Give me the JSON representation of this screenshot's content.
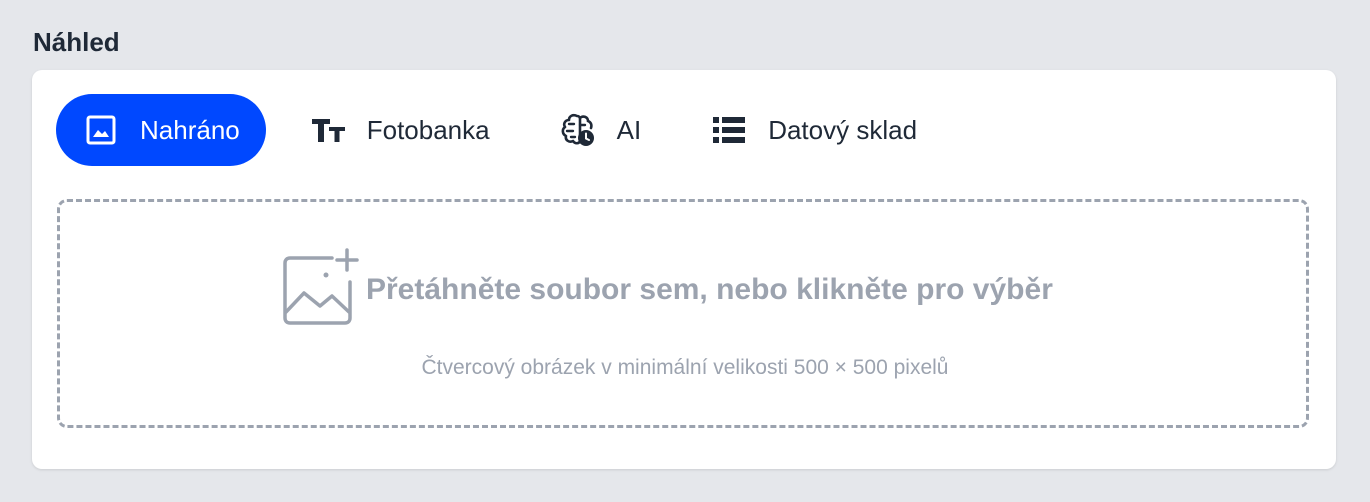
{
  "section": {
    "title": "Náhled"
  },
  "tabs": [
    {
      "label": "Nahráno",
      "icon": "image-icon",
      "active": true
    },
    {
      "label": "Fotobanka",
      "icon": "text-size-icon",
      "active": false
    },
    {
      "label": "AI",
      "icon": "brain-clock-icon",
      "active": false
    },
    {
      "label": "Datový sklad",
      "icon": "list-icon",
      "active": false
    }
  ],
  "dropzone": {
    "title": "Přetáhněte soubor sem, nebo klikněte pro výběr",
    "hint": "Čtvercový obrázek v minimální velikosti 500 × 500 pixelů",
    "icon": "image-plus-icon"
  },
  "colors": {
    "accent": "#0048ff",
    "background": "#e5e7eb",
    "muted": "#9ca3af",
    "text": "#1f2937"
  }
}
